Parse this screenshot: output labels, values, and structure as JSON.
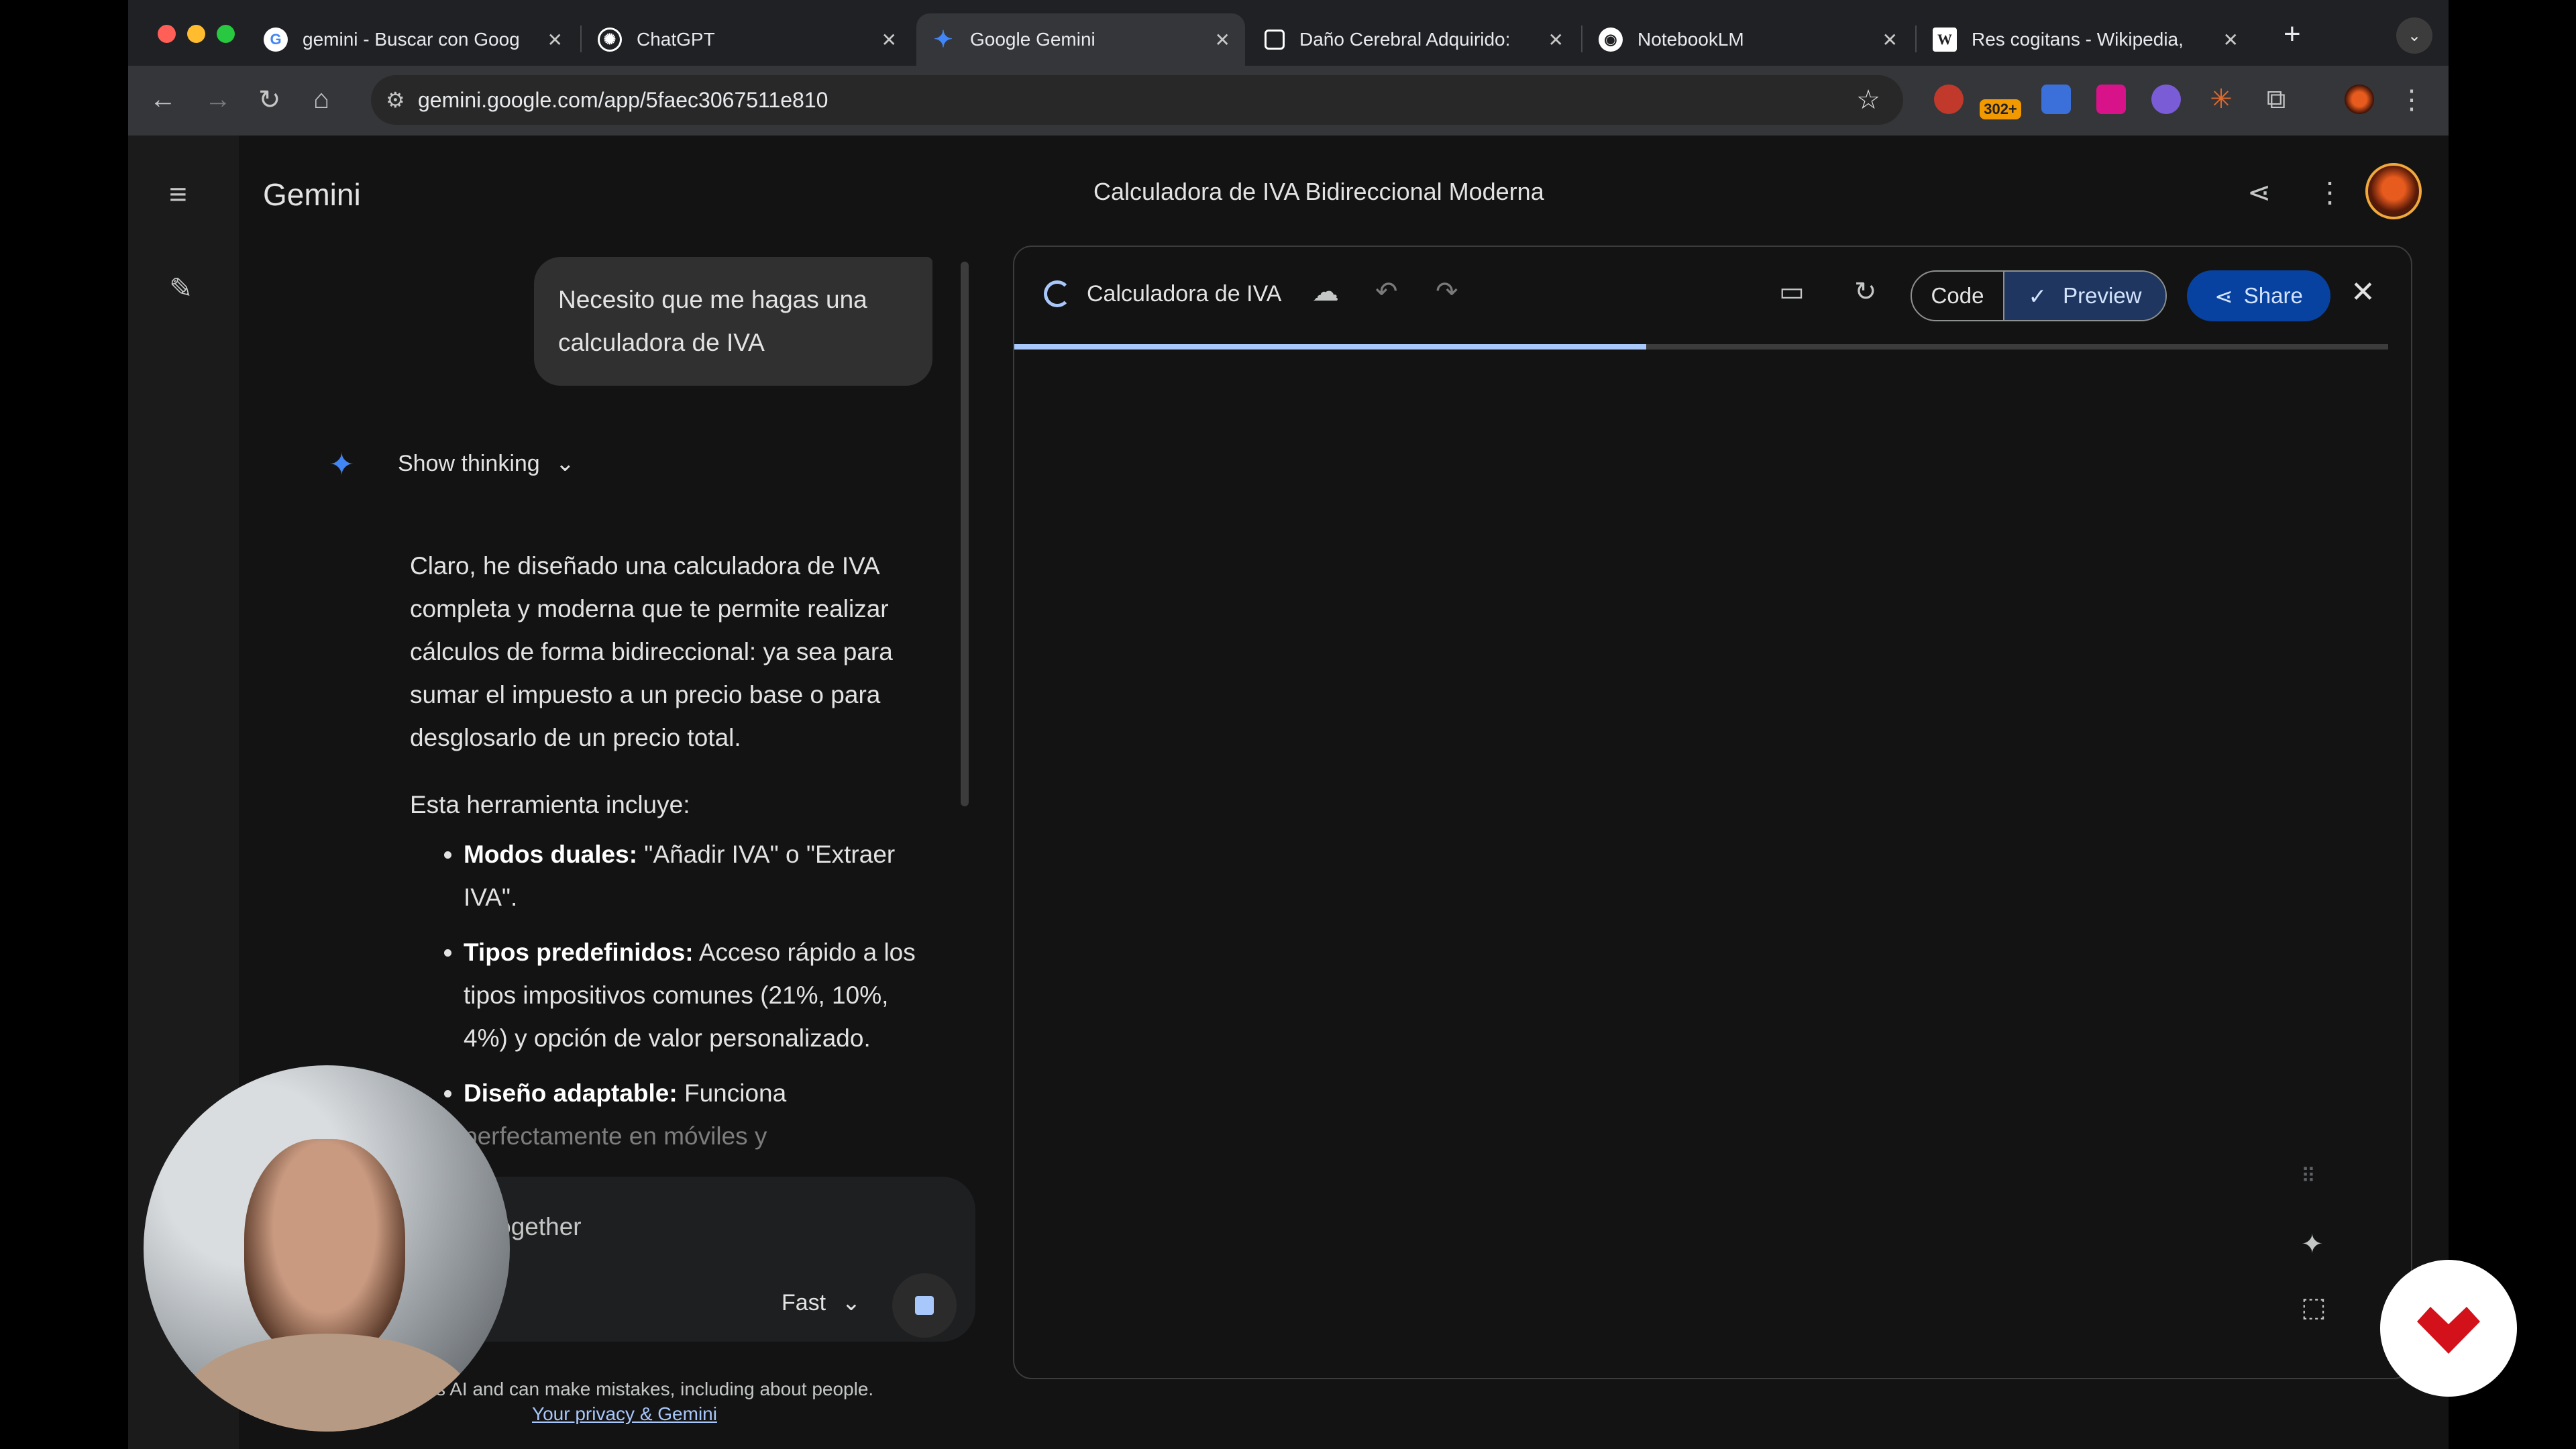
{
  "browser": {
    "tabs": [
      {
        "title": "gemini - Buscar con Goog",
        "favicon": "G",
        "fav_color": "#ea4335"
      },
      {
        "title": "ChatGPT",
        "favicon": "◎",
        "fav_color": "#ffffff"
      },
      {
        "title": "Google Gemini",
        "favicon": "✦",
        "fav_color": "#4285f4"
      },
      {
        "title": "Daño Cerebral Adquirido:",
        "favicon": "□",
        "fav_color": "#ffffff"
      },
      {
        "title": "NotebookLM",
        "favicon": "◑",
        "fav_color": "#ffffff"
      },
      {
        "title": "Res cogitans - Wikipedia,",
        "favicon": "W",
        "fav_color": "#ffffff"
      }
    ],
    "url": "gemini.google.com/app/5faec3067511e810",
    "extension_badge": "302+"
  },
  "app": {
    "brand": "Gemini",
    "document_title": "Calculadora de IVA Bidireccional Moderna"
  },
  "chat": {
    "user_message": "Necesito que me hagas una calculadora de IVA",
    "show_thinking": "Show thinking",
    "answer_paragraph": "Claro, he diseñado una calculadora de IVA completa y moderna que te permite realizar cálculos de forma bidireccional: ya sea para sumar el impuesto a un precio base o para desglosarlo de un precio total.",
    "list_intro": "Esta herramienta incluye:",
    "features": [
      {
        "label": "Modos duales:",
        "text": " \"Añadir IVA\" o \"Extraer IVA\"."
      },
      {
        "label": "Tipos predefinidos:",
        "text": " Acceso rápido a los tipos impositivos comunes (21%, 10%, 4%) y opción de valor personalizado."
      },
      {
        "label": "Diseño adaptable:",
        "text": " Funciona",
        "fade": "perfectamente en móviles y"
      }
    ],
    "input_text": "d together",
    "model": "Fast",
    "disclaimer": "s AI and can make mistakes, including about people.",
    "privacy_link": "Your privacy & Gemini"
  },
  "canvas": {
    "name": "Calculadora de IVA",
    "code_label": "Code",
    "preview_label": "Preview",
    "share_label": "Share",
    "progress": 0.46
  },
  "colors": {
    "accent": "#a8c7fa",
    "share_bg": "#0842a0",
    "background": "#131314"
  }
}
